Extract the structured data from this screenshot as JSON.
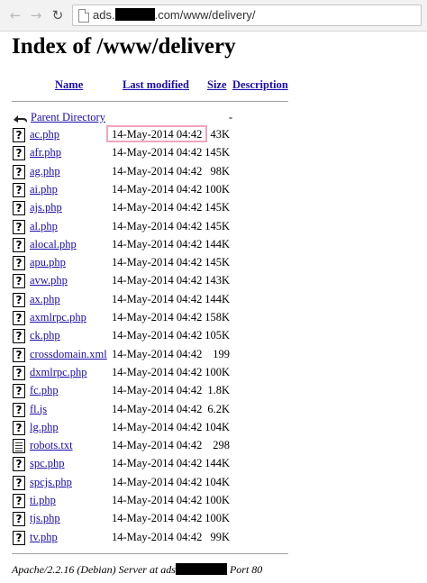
{
  "browser": {
    "url_prefix": "ads.",
    "url_suffix": ".com/www/delivery/"
  },
  "page": {
    "title": "Index of /www/delivery",
    "columns": {
      "name": "Name",
      "last_modified": "Last modified",
      "size": "Size",
      "description": "Description"
    },
    "parent": {
      "label": "Parent Directory",
      "size": "-"
    },
    "files": [
      {
        "name": "ac.php",
        "date": "14-May-2014 04:42",
        "size": "43K",
        "icon": "unknown-file-icon"
      },
      {
        "name": "afr.php",
        "date": "14-May-2014 04:42",
        "size": "145K",
        "icon": "unknown-file-icon"
      },
      {
        "name": "ag.php",
        "date": "14-May-2014 04:42",
        "size": "98K",
        "icon": "unknown-file-icon"
      },
      {
        "name": "ai.php",
        "date": "14-May-2014 04:42",
        "size": "100K",
        "icon": "unknown-file-icon"
      },
      {
        "name": "ajs.php",
        "date": "14-May-2014 04:42",
        "size": "145K",
        "icon": "unknown-file-icon"
      },
      {
        "name": "al.php",
        "date": "14-May-2014 04:42",
        "size": "145K",
        "icon": "unknown-file-icon"
      },
      {
        "name": "alocal.php",
        "date": "14-May-2014 04:42",
        "size": "144K",
        "icon": "unknown-file-icon"
      },
      {
        "name": "apu.php",
        "date": "14-May-2014 04:42",
        "size": "145K",
        "icon": "unknown-file-icon"
      },
      {
        "name": "avw.php",
        "date": "14-May-2014 04:42",
        "size": "143K",
        "icon": "unknown-file-icon"
      },
      {
        "name": "ax.php",
        "date": "14-May-2014 04:42",
        "size": "144K",
        "icon": "unknown-file-icon"
      },
      {
        "name": "axmlrpc.php",
        "date": "14-May-2014 04:42",
        "size": "158K",
        "icon": "unknown-file-icon"
      },
      {
        "name": "ck.php",
        "date": "14-May-2014 04:42",
        "size": "105K",
        "icon": "unknown-file-icon"
      },
      {
        "name": "crossdomain.xml",
        "date": "14-May-2014 04:42",
        "size": "199",
        "icon": "unknown-file-icon"
      },
      {
        "name": "dxmlrpc.php",
        "date": "14-May-2014 04:42",
        "size": "100K",
        "icon": "unknown-file-icon"
      },
      {
        "name": "fc.php",
        "date": "14-May-2014 04:42",
        "size": "1.8K",
        "icon": "unknown-file-icon"
      },
      {
        "name": "fl.js",
        "date": "14-May-2014 04:42",
        "size": "6.2K",
        "icon": "unknown-file-icon"
      },
      {
        "name": "lg.php",
        "date": "14-May-2014 04:42",
        "size": "104K",
        "icon": "unknown-file-icon"
      },
      {
        "name": "robots.txt",
        "date": "14-May-2014 04:42",
        "size": "298",
        "icon": "text-file-icon"
      },
      {
        "name": "spc.php",
        "date": "14-May-2014 04:42",
        "size": "144K",
        "icon": "unknown-file-icon"
      },
      {
        "name": "spcjs.php",
        "date": "14-May-2014 04:42",
        "size": "104K",
        "icon": "unknown-file-icon"
      },
      {
        "name": "ti.php",
        "date": "14-May-2014 04:42",
        "size": "100K",
        "icon": "unknown-file-icon"
      },
      {
        "name": "tjs.php",
        "date": "14-May-2014 04:42",
        "size": "100K",
        "icon": "unknown-file-icon"
      },
      {
        "name": "tv.php",
        "date": "14-May-2014 04:42",
        "size": "99K",
        "icon": "unknown-file-icon"
      }
    ],
    "footer_prefix": "Apache/2.2.16 (Debian) Server at ads",
    "footer_suffix": "Port 80"
  },
  "colors": {
    "link": "#1a0dab",
    "highlight": "#f2a3c0"
  }
}
